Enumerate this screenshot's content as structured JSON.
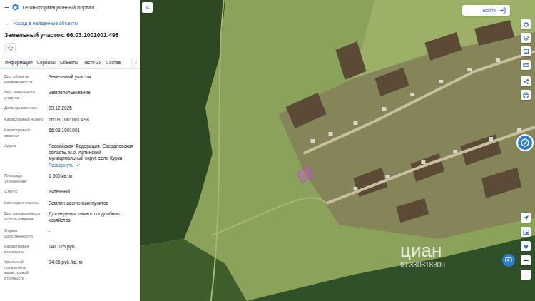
{
  "header": {
    "menu_icon": "≡",
    "title": "Геоинформационный портал"
  },
  "back_link": {
    "arrow": "←",
    "label": "Назад в найденные объекты"
  },
  "object_title": "Земельный участок: 66:03:1001001:498",
  "favorite": false,
  "tabs": [
    {
      "label": "Информация",
      "selected": true
    },
    {
      "label": "Сервисы",
      "selected": false
    },
    {
      "label": "Объекты",
      "selected": false
    },
    {
      "label": "Части ЗУ",
      "selected": false
    },
    {
      "label": "Состав",
      "selected": false
    }
  ],
  "tabs_next": "›",
  "fields": [
    {
      "label": "Вид объекта недвижимости",
      "value": "Земельный участок",
      "action": ""
    },
    {
      "label": "Вид земельного участка",
      "value": "Землепользование",
      "action": ""
    },
    {
      "label": "Дата присвоения",
      "value": "09.12.2025",
      "action": ""
    },
    {
      "label": "Кадастровый номер",
      "value": "66:03:1001001:498",
      "action": ""
    },
    {
      "label": "Кадастровый квартал",
      "value": "66:03:1001001",
      "action": ""
    },
    {
      "label": "Адрес",
      "value": "Российская Федерация, Свердловская область, м.о. Артинский муниципальный округ, село Курки,",
      "action": "Развернуть"
    },
    {
      "label": "Площадь уточненная",
      "value": "1 500 кв. м",
      "action": ""
    },
    {
      "label": "Статус",
      "value": "Учтенный",
      "action": ""
    },
    {
      "label": "Категория земель",
      "value": "Земли населенных пунктов",
      "action": ""
    },
    {
      "label": "Вид разрешенного использования",
      "value": "Для ведения личного подсобного хозяйства",
      "action": ""
    },
    {
      "label": "Форма собственности",
      "value": "-",
      "action": ""
    },
    {
      "label": "Кадастровая стоимость",
      "value": "141 075 руб.",
      "action": ""
    },
    {
      "label": "Удельный показатель кадастровой стоимости",
      "value": "94,05 руб./кв. м",
      "action": ""
    }
  ],
  "map": {
    "collapse": "«",
    "login": "Войти",
    "watermark": "циан",
    "watermark_id": "ID 330318309"
  }
}
